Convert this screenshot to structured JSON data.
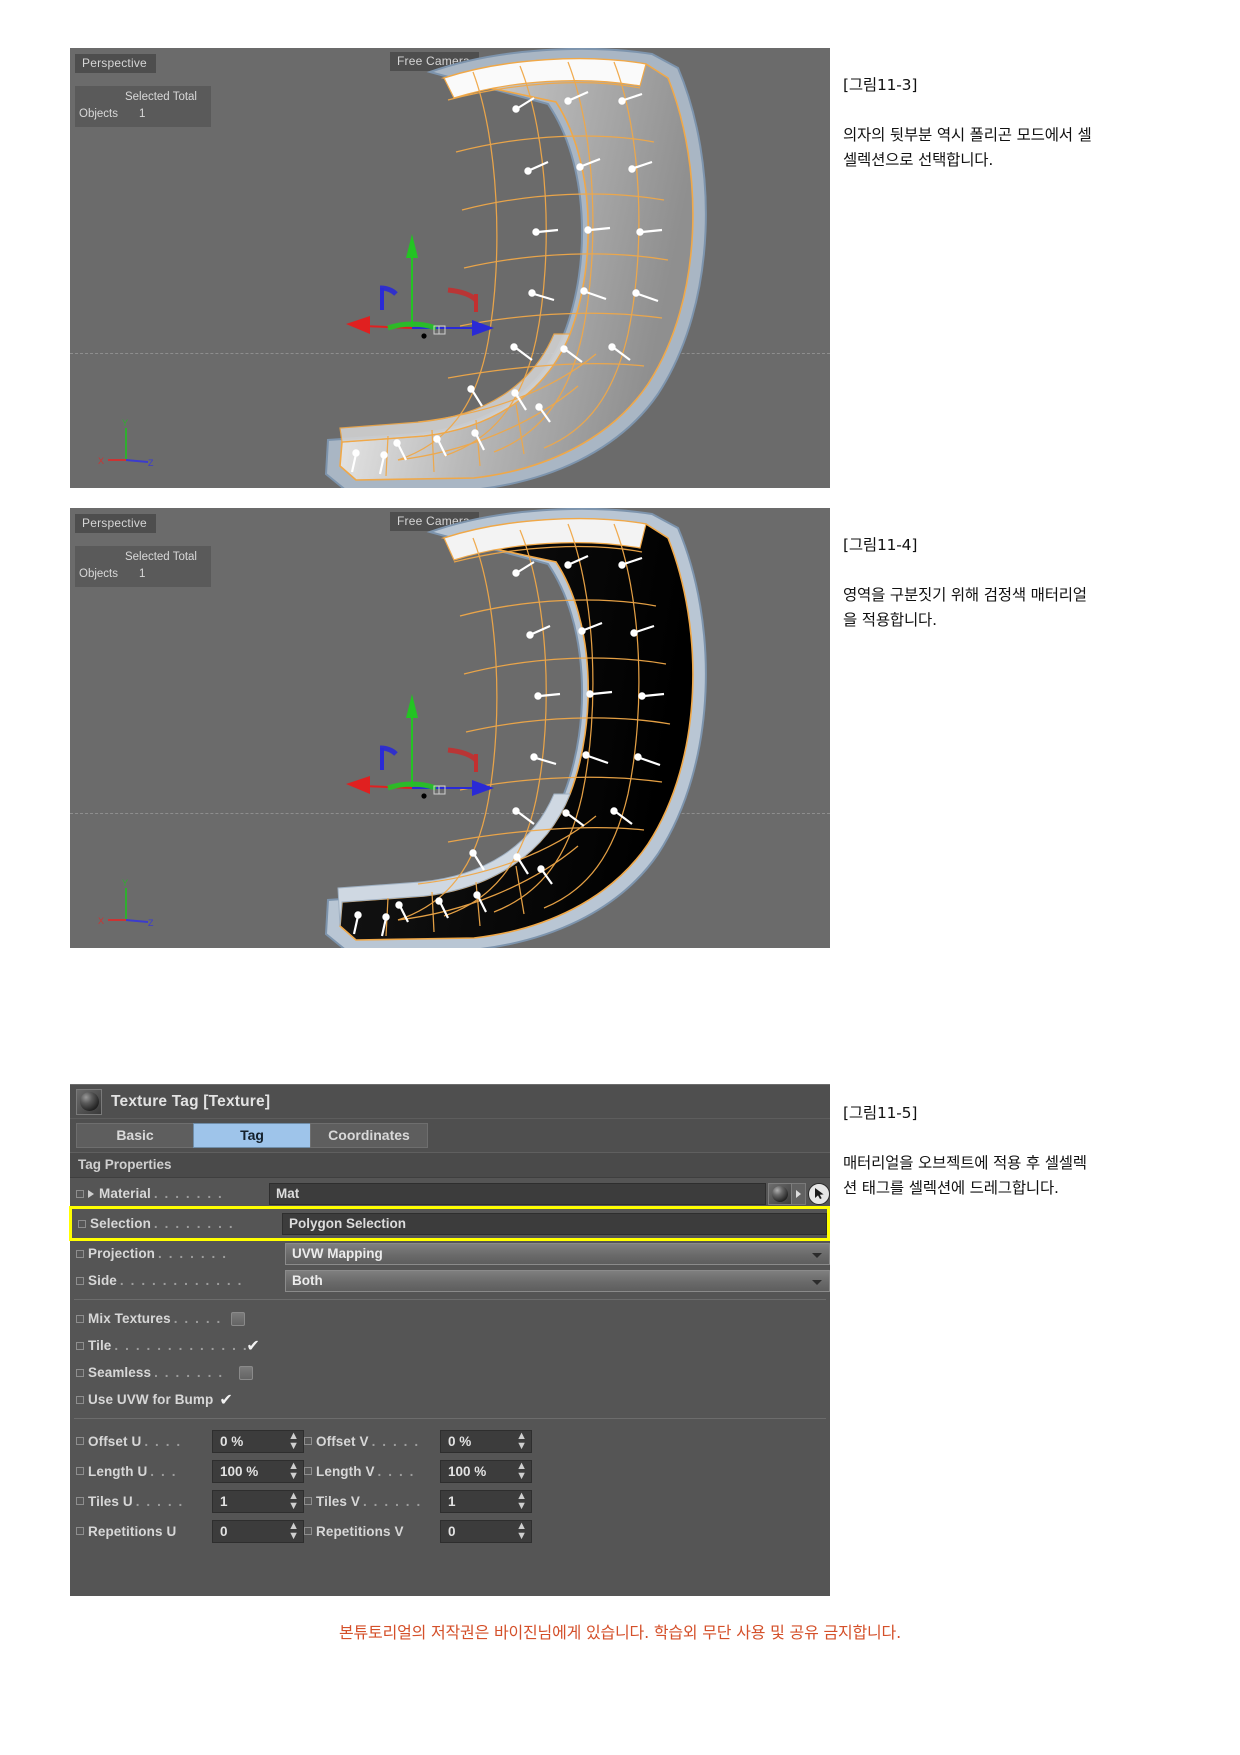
{
  "viewports": [
    {
      "id": "viewport-1",
      "perspective_label": "Perspective",
      "camera_label": "Free Camera",
      "stats_header": "Selected Total",
      "stats_row_label": "Objects",
      "stats_row_value": "1",
      "axis_x": "X",
      "axis_y": "Y",
      "axis_z": "Z",
      "surface_mode": "light-gray-shaded"
    },
    {
      "id": "viewport-2",
      "perspective_label": "Perspective",
      "camera_label": "Free Camera",
      "stats_header": "Selected Total",
      "stats_row_label": "Objects",
      "stats_row_value": "1",
      "axis_x": "X",
      "axis_y": "Y",
      "axis_z": "Z",
      "surface_mode": "black-material"
    }
  ],
  "captions": [
    {
      "title": "[그림11-3]",
      "body": "의자의 뒷부분 역시 폴리곤 모드에서 셀\n셀렉션으로 선택합니다."
    },
    {
      "title": "[그림11-4]",
      "body": "영역을 구분짓기 위해 검정색 매터리얼\n을 적용합니다."
    },
    {
      "title": "[그림11-5]",
      "body": "매터리얼을 오브젝트에 적용 후 셀셀렉\n션 태그를 셀렉션에 드레그합니다."
    }
  ],
  "texture_tag": {
    "window_title": "Texture Tag [Texture]",
    "tabs": [
      {
        "label": "Basic",
        "active": false
      },
      {
        "label": "Tag",
        "active": true
      },
      {
        "label": "Coordinates",
        "active": false
      }
    ],
    "section_title": "Tag Properties",
    "fields": {
      "material": {
        "label": "Material",
        "dots": ". . . . . . .",
        "value": "Mat"
      },
      "selection": {
        "label": "Selection",
        "dots": ". . . . . . . .",
        "value": "Polygon Selection",
        "highlighted": true,
        "highlight_color": "#ffff00"
      },
      "projection": {
        "label": "Projection",
        "dots": ". . . . . . .",
        "value": "UVW Mapping"
      },
      "side": {
        "label": "Side",
        "dots": ". . . . . . . . . . . .",
        "value": "Both"
      }
    },
    "checkboxes": [
      {
        "label": "Mix Textures",
        "dots": ". . . . .",
        "checked": false
      },
      {
        "label": "Tile",
        "dots": ". . . . . . . . . . . . .",
        "checked": true
      },
      {
        "label": "Seamless",
        "dots": ". . . . . . .",
        "checked": false
      },
      {
        "label": "Use UVW for Bump",
        "dots": "",
        "checked": true
      }
    ],
    "numeric_rows": [
      [
        {
          "label": "Offset U",
          "dots": ". . . .",
          "value": "0 %"
        },
        {
          "label": "Offset V",
          "dots": ". . . . .",
          "value": "0 %"
        }
      ],
      [
        {
          "label": "Length U",
          "dots": ". . .",
          "value": "100 %"
        },
        {
          "label": "Length V",
          "dots": ". . . .",
          "value": "100 %"
        }
      ],
      [
        {
          "label": "Tiles U",
          "dots": ". . . . .",
          "value": "1"
        },
        {
          "label": "Tiles V",
          "dots": ". . . . . .",
          "value": "1"
        }
      ],
      [
        {
          "label": "Repetitions U",
          "dots": "",
          "value": "0"
        },
        {
          "label": "Repetitions V",
          "dots": "",
          "value": "0"
        }
      ]
    ]
  },
  "footer": {
    "note": "본튜토리얼의 저작권은 바이진님에게 있습니다. 학습외 무단 사용 및 공유 금지합니다.",
    "color": "#d4502a"
  }
}
